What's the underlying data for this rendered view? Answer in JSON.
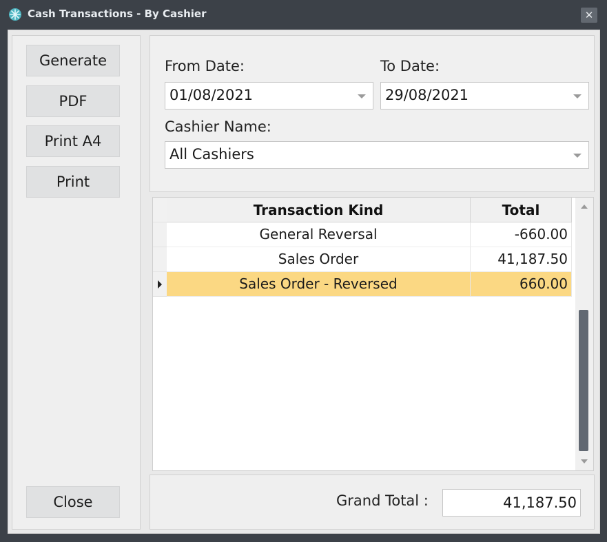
{
  "window": {
    "title": "Cash Transactions - By Cashier",
    "close_symbol": "✕"
  },
  "sidebar": {
    "generate_label": "Generate",
    "pdf_label": "PDF",
    "print_a4_label": "Print A4",
    "print_label": "Print",
    "close_label": "Close"
  },
  "filters": {
    "from_date_label": "From Date:",
    "from_date_value": "01/08/2021",
    "to_date_label": "To Date:",
    "to_date_value": "29/08/2021",
    "cashier_label": "Cashier Name:",
    "cashier_value": "All Cashiers"
  },
  "grid": {
    "columns": [
      "Transaction Kind",
      "Total"
    ],
    "rows": [
      {
        "kind": "General Reversal",
        "total": "-660.00",
        "selected": false
      },
      {
        "kind": "Sales Order",
        "total": "41,187.50",
        "selected": false
      },
      {
        "kind": "Sales Order - Reversed",
        "total": "660.00",
        "selected": true
      }
    ]
  },
  "footer": {
    "grand_total_label": "Grand Total :",
    "grand_total_value": "41,187.50"
  },
  "colors": {
    "titlebar": "#3c4148",
    "selected_row": "#fbd883",
    "scroll_thumb": "#616872"
  }
}
